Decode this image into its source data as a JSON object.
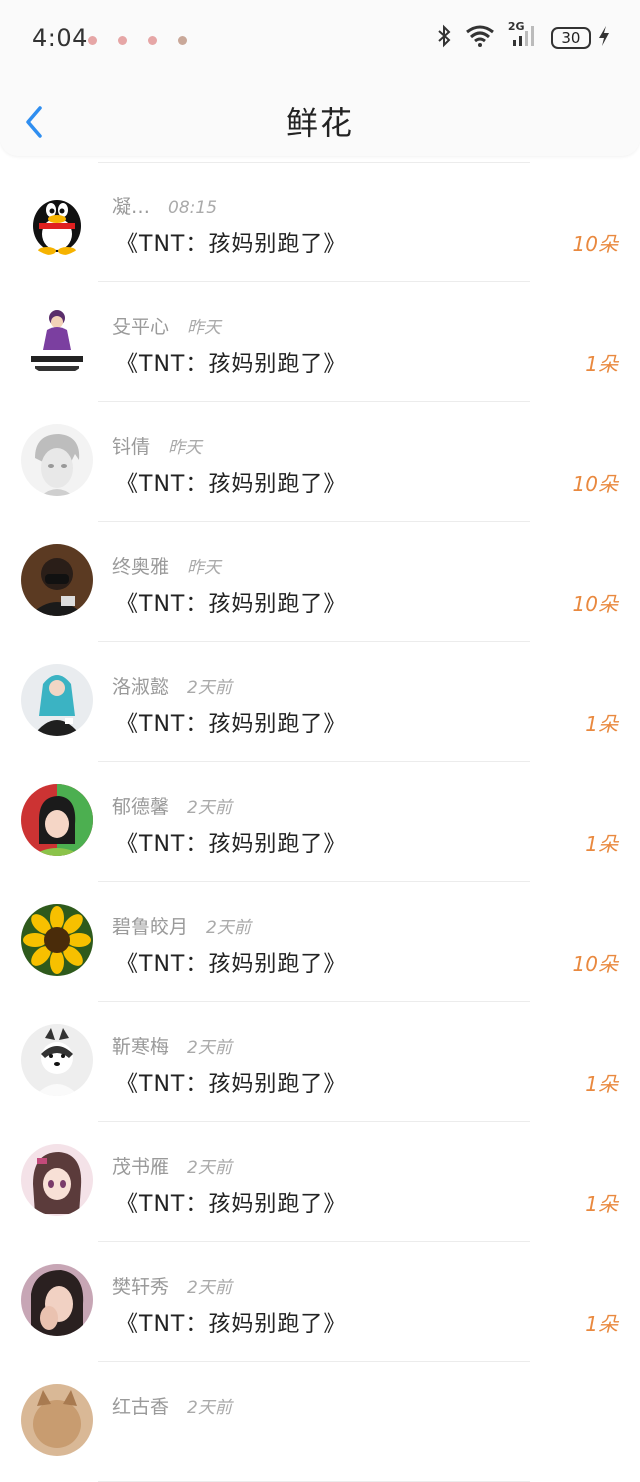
{
  "status_bar": {
    "time": "4:04",
    "network": "2G",
    "battery": "30"
  },
  "nav": {
    "title": "鲜花"
  },
  "accent_color": "#2f8ef0",
  "count_color": "#e9893f",
  "items": [
    {
      "name": "凝…",
      "time": "08:15",
      "book": "《TNT：孩妈别跑了》",
      "count": "10朵",
      "avatar": "qq-penguin"
    },
    {
      "name": "殳平心",
      "time": "昨天",
      "book": "《TNT：孩妈别跑了》",
      "count": "1朵",
      "avatar": "cartoon-girl-sticker"
    },
    {
      "name": "钭倩",
      "time": "昨天",
      "book": "《TNT：孩妈别跑了》",
      "count": "10朵",
      "avatar": "anime-boy-sketch"
    },
    {
      "name": "终奥雅",
      "time": "昨天",
      "book": "《TNT：孩妈别跑了》",
      "count": "10朵",
      "avatar": "masked-person"
    },
    {
      "name": "洛淑懿",
      "time": "2天前",
      "book": "《TNT：孩妈别跑了》",
      "count": "1朵",
      "avatar": "cosplay-blue-hair"
    },
    {
      "name": "郁德馨",
      "time": "2天前",
      "book": "《TNT：孩妈别跑了》",
      "count": "1朵",
      "avatar": "girl-green"
    },
    {
      "name": "碧鲁皎月",
      "time": "2天前",
      "book": "《TNT：孩妈别跑了》",
      "count": "10朵",
      "avatar": "sunflower"
    },
    {
      "name": "靳寒梅",
      "time": "2天前",
      "book": "《TNT：孩妈别跑了》",
      "count": "1朵",
      "avatar": "husky-dog"
    },
    {
      "name": "茂书雁",
      "time": "2天前",
      "book": "《TNT：孩妈别跑了》",
      "count": "1朵",
      "avatar": "anime-girl"
    },
    {
      "name": "樊轩秀",
      "time": "2天前",
      "book": "《TNT：孩妈别跑了》",
      "count": "1朵",
      "avatar": "girl-hand-face"
    },
    {
      "name": "红古香",
      "time": "2天前",
      "book": "",
      "count": "",
      "avatar": "cat-partial"
    }
  ]
}
